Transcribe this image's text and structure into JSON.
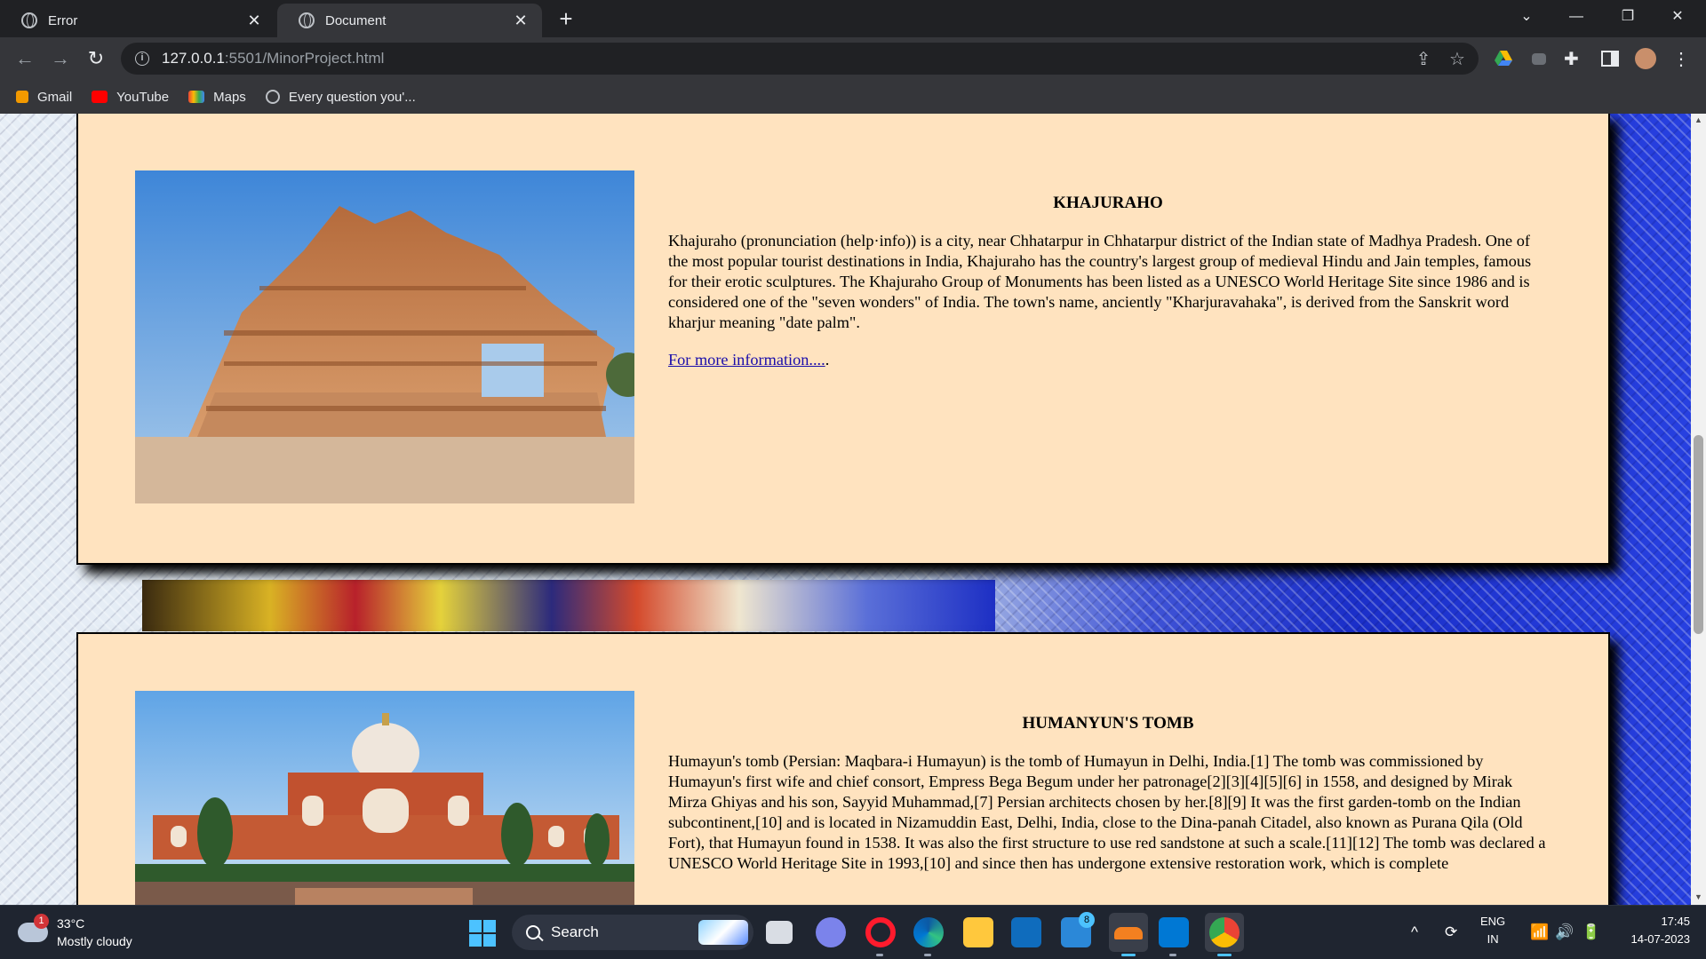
{
  "browser": {
    "tabs": [
      {
        "title": "Error",
        "active": false
      },
      {
        "title": "Document",
        "active": true
      }
    ],
    "url_host": "127.0.0.1",
    "url_path": ":5501/MinorProject.html",
    "bookmarks": [
      "Gmail",
      "YouTube",
      "Maps",
      "Every question you'..."
    ]
  },
  "page": {
    "cards": [
      {
        "title": "KHAJURAHO",
        "body": "Khajuraho (pronunciation (help·info)) is a city, near Chhatarpur in Chhatarpur district of the Indian state of Madhya Pradesh. One of the most popular tourist destinations in India, Khajuraho has the country's largest group of medieval Hindu and Jain temples, famous for their erotic sculptures. The Khajuraho Group of Monuments has been listed as a UNESCO World Heritage Site since 1986 and is considered one of the \"seven wonders\" of India. The town's name, anciently \"Kharjuravahaka\", is derived from the Sanskrit word kharjur meaning \"date palm\".",
        "link": "For more information....",
        "link_suffix": "."
      },
      {
        "title": "HUMANYUN'S TOMB",
        "body": "Humayun's tomb (Persian: Maqbara-i Humayun) is the tomb of Humayun in Delhi, India.[1] The tomb was commissioned by Humayun's first wife and chief consort, Empress Bega Begum under her patronage[2][3][4][5][6] in 1558, and designed by Mirak Mirza Ghiyas and his son, Sayyid Muhammad,[7] Persian architects chosen by her.[8][9] It was the first garden-tomb on the Indian subcontinent,[10] and is located in Nizamuddin East, Delhi, India, close to the Dina-panah Citadel, also known as Purana Qila (Old Fort), that Humayun found in 1538. It was also the first structure to use red sandstone at such a scale.[11][12] The tomb was declared a UNESCO World Heritage Site in 1993,[10] and since then has undergone extensive restoration work, which is complete"
      }
    ]
  },
  "taskbar": {
    "weather_temp": "33°C",
    "weather_desc": "Mostly cloudy",
    "weather_badge": "1",
    "search_label": "Search",
    "mail_badge": "8",
    "lang_1": "ENG",
    "lang_2": "IN",
    "time": "17:45",
    "date": "14-07-2023"
  }
}
